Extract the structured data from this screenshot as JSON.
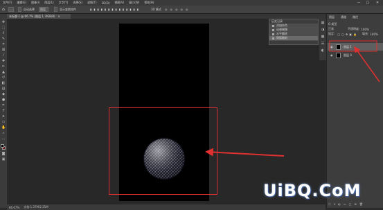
{
  "menubar": {
    "items": [
      "文件(F)",
      "编辑(E)",
      "图像(I)",
      "图层(L)",
      "文字(Y)",
      "选择(S)",
      "滤镜(T)",
      "3D(D)",
      "视图(V)",
      "窗口(W)",
      "帮助(H)"
    ],
    "minimize": "—",
    "maximize": "□",
    "close": "✕"
  },
  "options": {
    "home": "⌂",
    "auto_select": "自动选择",
    "layer_select": "图层",
    "show_transform": "显示变换控件",
    "mode_3d": "3D 模式"
  },
  "document": {
    "tab_label": "未标题-1 @ 66.7% (图层 1, RGB/8)",
    "close": "×"
  },
  "history": {
    "title": "历史记录",
    "items": [
      "添加杂色",
      "动感模糊",
      "水平翻转",
      "铜版雕刻"
    ],
    "active_index": 3
  },
  "layers_panel": {
    "tabs": [
      "图层",
      "通道",
      "路径"
    ],
    "kind_label": "Q 类型",
    "blend_mode": "正常",
    "opacity_label": "不透明度:",
    "opacity": "100%",
    "lock_label": "锁定:",
    "fill_label": "填充:",
    "fill": "100%",
    "layers": [
      {
        "name": "图层 1",
        "selected": true
      },
      {
        "name": "图层 0",
        "selected": false
      }
    ]
  },
  "status": {
    "zoom": "66.67%",
    "info": "文档:1.37M/2.25M"
  },
  "watermark": "UiBQ.CoM",
  "colors": {
    "annotation_red": "#e03030",
    "foreground": "#000000",
    "background": "#7a1a1a"
  }
}
